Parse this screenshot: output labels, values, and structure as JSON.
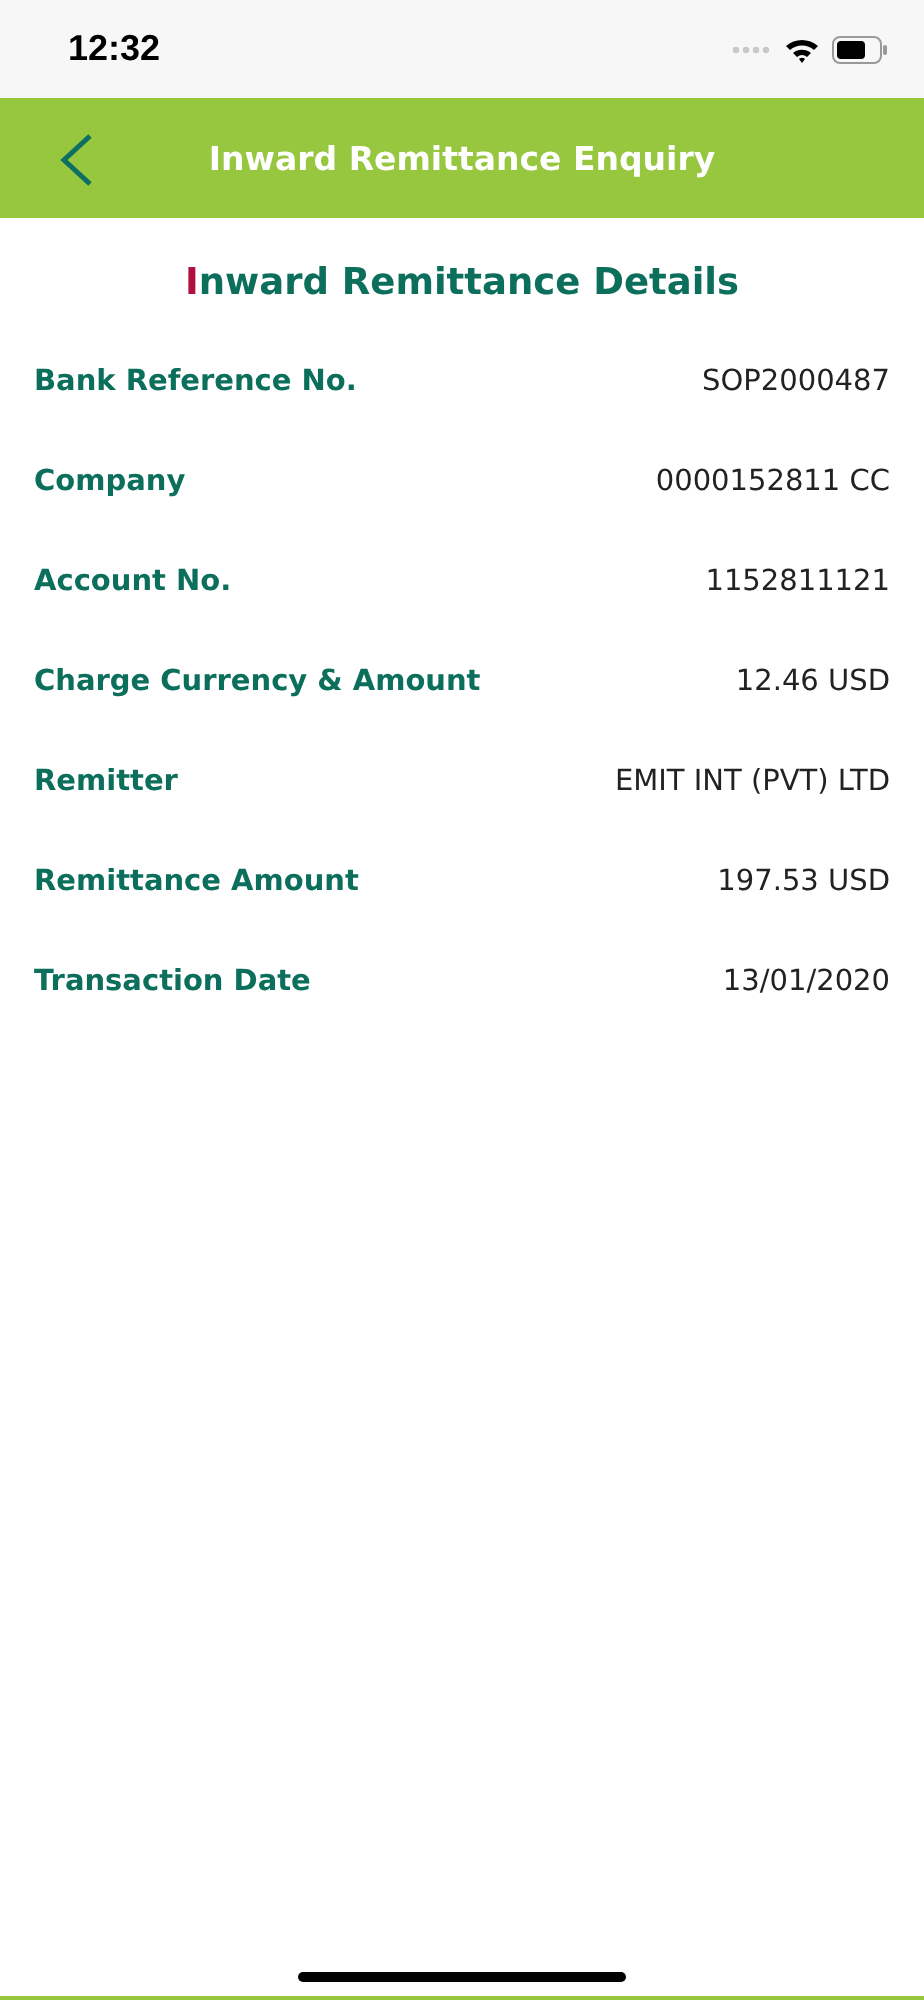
{
  "status_bar": {
    "time": "12:32"
  },
  "header": {
    "title": "Inward Remittance Enquiry"
  },
  "heading": {
    "initial": "I",
    "rest": "nward Remittance Details"
  },
  "details": [
    {
      "label": "Bank Reference No.",
      "value": "SOP2000487"
    },
    {
      "label": "Company",
      "value": "0000152811 CC"
    },
    {
      "label": "Account No.",
      "value": "1152811121"
    },
    {
      "label": "Charge Currency & Amount",
      "value": "12.46 USD"
    },
    {
      "label": "Remitter",
      "value": "EMIT INT (PVT) LTD"
    },
    {
      "label": "Remittance Amount",
      "value": "197.53 USD"
    },
    {
      "label": "Transaction Date",
      "value": "13/01/2020"
    }
  ]
}
